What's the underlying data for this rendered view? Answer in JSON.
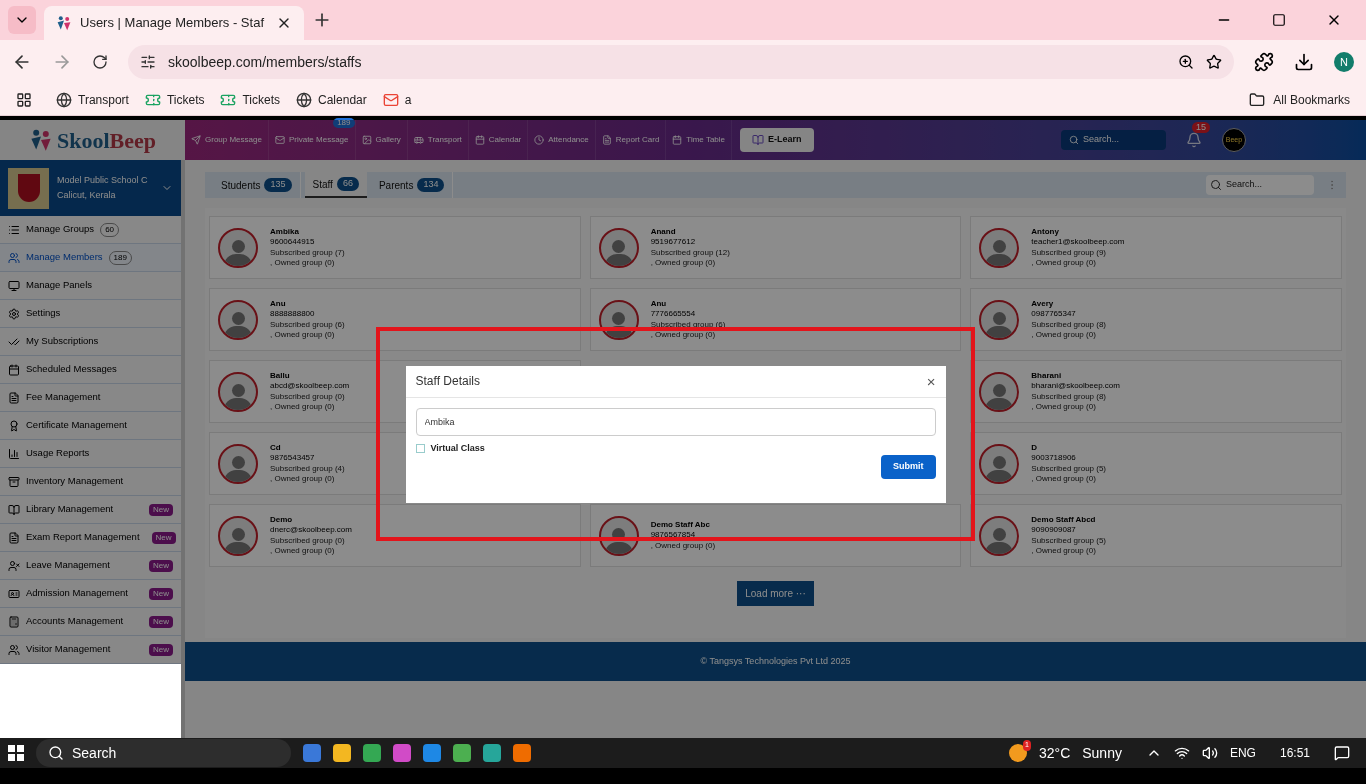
{
  "browser": {
    "tab_title": "Users | Manage Members - Staf",
    "url": "skoolbeep.com/members/staffs",
    "profile_initial": "N",
    "all_bookmarks": "All Bookmarks",
    "bookmarks": [
      {
        "label": "Transport",
        "kind": "globe"
      },
      {
        "label": "Tickets",
        "kind": "ticket"
      },
      {
        "label": "Tickets",
        "kind": "ticket"
      },
      {
        "label": "Calendar",
        "kind": "globe"
      },
      {
        "label": "a",
        "kind": "mail"
      }
    ]
  },
  "header": {
    "logo_first": "Skool",
    "logo_second": "Beep",
    "elearn": "E-Learn",
    "search_placeholder": "Search...",
    "notification_count": "15",
    "avatar_text": "Beep",
    "nav": [
      {
        "label": "Group Message"
      },
      {
        "label": "Private Message",
        "badge": "189"
      },
      {
        "label": "Gallery"
      },
      {
        "label": "Transport"
      },
      {
        "label": "Calendar"
      },
      {
        "label": "Attendance"
      },
      {
        "label": "Report Card"
      },
      {
        "label": "Time Table"
      }
    ]
  },
  "school": {
    "name": "Model Public School C",
    "location": "Calicut, Kerala"
  },
  "sidebar": {
    "items": [
      {
        "label": "Manage Groups",
        "count": "60",
        "selected": false
      },
      {
        "label": "Manage Members",
        "count": "189",
        "selected": true
      },
      {
        "label": "Manage Panels",
        "selected": false
      },
      {
        "label": "Settings",
        "selected": false
      },
      {
        "label": "My Subscriptions",
        "selected": false
      },
      {
        "label": "Scheduled Messages",
        "selected": false
      },
      {
        "label": "Fee Management",
        "selected": false
      },
      {
        "label": "Certificate Management",
        "selected": false
      },
      {
        "label": "Usage Reports",
        "selected": false
      },
      {
        "label": "Inventory Management",
        "selected": false
      },
      {
        "label": "Library Management",
        "badge": "New",
        "selected": false
      },
      {
        "label": "Exam Report Management",
        "badge": "New",
        "selected": false
      },
      {
        "label": "Leave Management",
        "badge": "New",
        "selected": false
      },
      {
        "label": "Admission Management",
        "badge": "New",
        "selected": false
      },
      {
        "label": "Accounts Management",
        "badge": "New",
        "selected": false
      },
      {
        "label": "Visitor Management",
        "badge": "New",
        "selected": false
      }
    ]
  },
  "tabs": [
    {
      "label": "Students",
      "count": "135",
      "selected": false
    },
    {
      "label": "Staff",
      "count": "66",
      "selected": true
    },
    {
      "label": "Parents",
      "count": "134",
      "selected": false
    }
  ],
  "member_search": {
    "placeholder": "Search..."
  },
  "card_rows": [
    {
      "cards": [
        {
          "name": "Ambika",
          "contact": "9600644915",
          "subscribed": "Subscribed group (7)",
          "owned": ", Owned group (0)"
        },
        {
          "name": "Anand",
          "contact": "9519677612",
          "subscribed": "Subscribed group (12)",
          "owned": ", Owned group (0)"
        },
        {
          "name": "Antony",
          "contact": "teacher1@skoolbeep.com",
          "subscribed": "Subscribed group (9)",
          "owned": ", Owned group (0)"
        }
      ]
    },
    {
      "cards": [
        {
          "name": "Anu",
          "contact": "8888888800",
          "subscribed": "Subscribed group (6)",
          "owned": ", Owned group (0)"
        },
        {
          "name": "Anu",
          "contact": "7776665554",
          "subscribed": "Subscribed group (6)",
          "owned": ", Owned group (0)"
        },
        {
          "name": "Avery",
          "contact": "0987765347",
          "subscribed": "Subscribed group (8)",
          "owned": ", Owned group (0)"
        }
      ]
    },
    {
      "cards": [
        {
          "name": "Ballu",
          "contact": "abcd@skoolbeep.com",
          "subscribed": "Subscribed group (0)",
          "owned": ", Owned group (0)"
        },
        {
          "name": "Bharani",
          "contact": "bharani@skoolbeep.com",
          "subscribed": "Subscribed group (8)",
          "owned": ", Owned group (0)"
        }
      ]
    },
    {
      "cards": [
        {
          "name": "Cd",
          "contact": "9876543457",
          "subscribed": "Subscribed group (4)",
          "owned": ", Owned group (0)"
        },
        {
          "name": "D",
          "contact": "9003718906",
          "subscribed": "Subscribed group (5)",
          "owned": ", Owned group (0)"
        }
      ]
    },
    {
      "cards": [
        {
          "name": "Demo",
          "contact": "dnerc@skoolbeep.com",
          "subscribed": "Subscribed group (0)",
          "owned": ", Owned group (0)"
        },
        {
          "name": "Demo Staff Abc",
          "contact": "9876567854",
          "owned": ", Owned group (0)"
        },
        {
          "name": "Demo Staff Abcd",
          "contact": "9090909087",
          "subscribed": "Subscribed group (5)",
          "owned": ", Owned group (0)"
        }
      ]
    }
  ],
  "load_more": "Load more ···",
  "footer": "© Tangsys Technologies Pvt Ltd 2025",
  "modal": {
    "title": "Staff Details",
    "close": "×",
    "name_value": "Ambika",
    "checkbox": {
      "label": "Virtual Class",
      "checked": false
    },
    "submit": "Submit"
  },
  "taskbar": {
    "search": "Search",
    "weather_alert": "1",
    "temperature": "32°C",
    "condition": "Sunny",
    "language": "ENG",
    "time": "16:51"
  }
}
